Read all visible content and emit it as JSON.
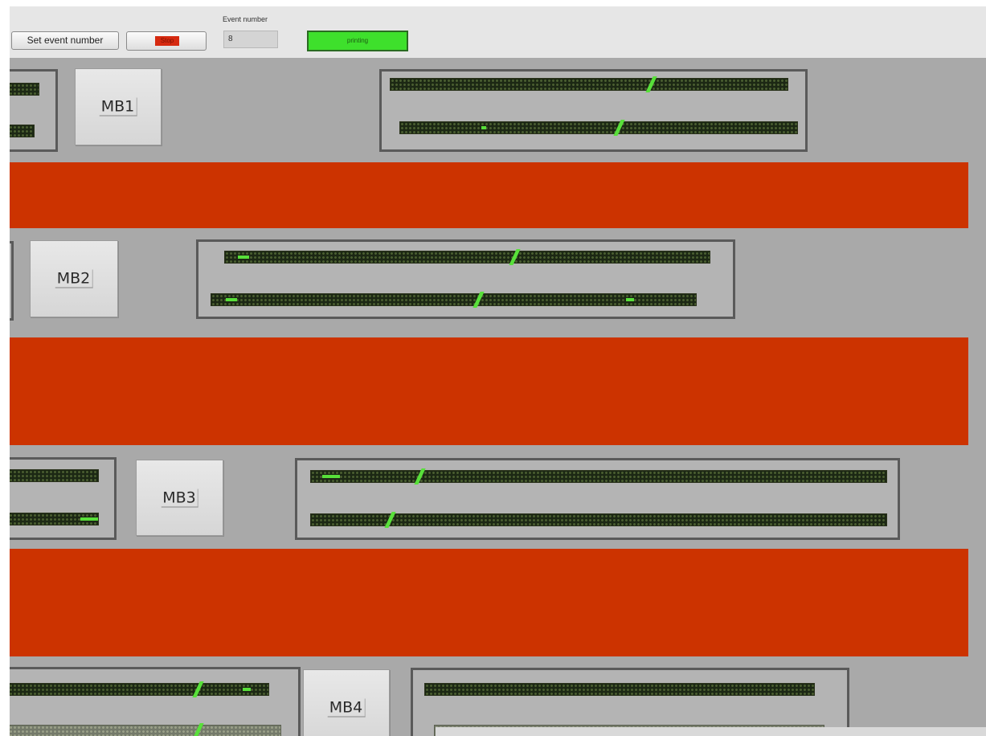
{
  "toolbar": {
    "set_event_number_label": "Set event number",
    "stop_label": "Stop",
    "event_number_label": "Event number",
    "event_number_value": "8",
    "status_label": "printing"
  },
  "colors": {
    "band": "#cc3300",
    "status_on": "#3ee02c",
    "led": "#58e03a",
    "background": "#a9a9a9"
  },
  "modules": [
    {
      "label": "MB1"
    },
    {
      "label": "MB2"
    },
    {
      "label": "MB3"
    },
    {
      "label": "MB4"
    }
  ]
}
